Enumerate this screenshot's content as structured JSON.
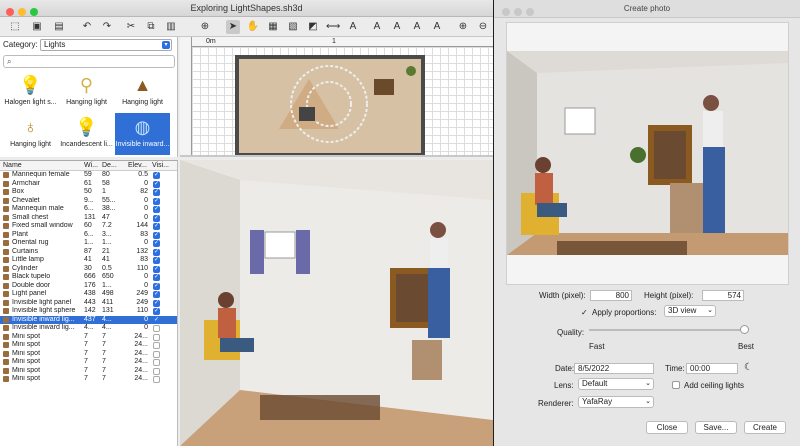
{
  "window": {
    "title": "Exploring LightShapes.sh3d"
  },
  "catalog": {
    "category_label": "Category:",
    "category_value": "Lights",
    "items": [
      {
        "label": "Halogen light s...",
        "icon": "halogen-bulb-icon"
      },
      {
        "label": "Hanging light",
        "icon": "hanging-light-icon"
      },
      {
        "label": "Hanging light",
        "icon": "hanging-light-icon"
      },
      {
        "label": "Hanging light",
        "icon": "hanging-light-icon"
      },
      {
        "label": "Incandescent li...",
        "icon": "incandescent-bulb-icon"
      },
      {
        "label": "Invisible inward...",
        "icon": "invisible-sphere-icon"
      }
    ]
  },
  "furniture": {
    "headers": [
      "Name",
      "Wi...",
      "De...",
      "Elev...",
      "Visi..."
    ],
    "rows": [
      {
        "name": "Mannequin female",
        "w": "59",
        "d": "80",
        "e": "0.5",
        "v": true
      },
      {
        "name": "Armchair",
        "w": "61",
        "d": "58",
        "e": "0",
        "v": true
      },
      {
        "name": "Box",
        "w": "50",
        "d": "1",
        "e": "82",
        "v": true
      },
      {
        "name": "Chevalet",
        "w": "9...",
        "d": "55...",
        "e": "0",
        "v": true
      },
      {
        "name": "Mannequin male",
        "w": "6...",
        "d": "38...",
        "e": "0",
        "v": true
      },
      {
        "name": "Small chest",
        "w": "131",
        "d": "47",
        "e": "0",
        "v": true
      },
      {
        "name": "Fixed small window",
        "w": "60",
        "d": "7.2",
        "e": "144",
        "v": true
      },
      {
        "name": "Plant",
        "w": "6...",
        "d": "3...",
        "e": "83",
        "v": true
      },
      {
        "name": "Oriental rug",
        "w": "1...",
        "d": "1...",
        "e": "0",
        "v": true
      },
      {
        "name": "Curtains",
        "w": "87",
        "d": "21",
        "e": "132",
        "v": true
      },
      {
        "name": "Little lamp",
        "w": "41",
        "d": "41",
        "e": "83",
        "v": true
      },
      {
        "name": "Cylinder",
        "w": "30",
        "d": "0.5",
        "e": "110",
        "v": true
      },
      {
        "name": "Black tupelo",
        "w": "666",
        "d": "650",
        "e": "0",
        "v": true
      },
      {
        "name": "Double door",
        "w": "176",
        "d": "1...",
        "e": "0",
        "v": true
      },
      {
        "name": "Light panel",
        "w": "438",
        "d": "498",
        "e": "249",
        "v": true
      },
      {
        "name": "Invisible light panel",
        "w": "443",
        "d": "411",
        "e": "249",
        "v": true
      },
      {
        "name": "Invisible light sphere",
        "w": "142",
        "d": "131",
        "e": "110",
        "v": true
      },
      {
        "name": "Invisible inward lig...",
        "w": "437",
        "d": "4...",
        "e": "0",
        "v": true,
        "selected": true
      },
      {
        "name": "Invisible inward lig...",
        "w": "4...",
        "d": "4...",
        "e": "0",
        "v": false
      },
      {
        "name": "Mini spot",
        "w": "7",
        "d": "7",
        "e": "24...",
        "v": false
      },
      {
        "name": "Mini spot",
        "w": "7",
        "d": "7",
        "e": "24...",
        "v": false
      },
      {
        "name": "Mini spot",
        "w": "7",
        "d": "7",
        "e": "24...",
        "v": false
      },
      {
        "name": "Mini spot",
        "w": "7",
        "d": "7",
        "e": "24...",
        "v": false
      },
      {
        "name": "Mini spot",
        "w": "7",
        "d": "7",
        "e": "24...",
        "v": false
      },
      {
        "name": "Mini spot",
        "w": "7",
        "d": "7",
        "e": "24...",
        "v": false
      }
    ]
  },
  "plan": {
    "ruler_origin": "0m",
    "ruler_mark": "1"
  },
  "dialog": {
    "title": "Create photo",
    "width_label": "Width (pixel):",
    "width_value": "800",
    "height_label": "Height (pixel):",
    "height_value": "574",
    "apply_label": "Apply proportions:",
    "apply_checked": true,
    "view_value": "3D view",
    "quality_label": "Quality:",
    "quality_min": "Fast",
    "quality_max": "Best",
    "quality_level": 1.0,
    "date_label": "Date:",
    "date_value": "8/5/2022",
    "time_label": "Time:",
    "time_value": "00:00",
    "lens_label": "Lens:",
    "lens_value": "Default",
    "ceiling_label": "Add ceiling lights",
    "ceiling_checked": false,
    "renderer_label": "Renderer:",
    "renderer_value": "YafaRay",
    "close_label": "Close",
    "save_label": "Save...",
    "create_label": "Create"
  }
}
